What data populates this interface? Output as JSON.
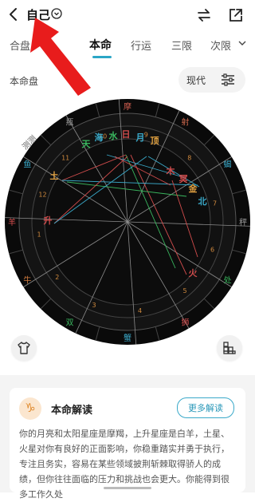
{
  "header": {
    "title": "自己"
  },
  "tabs": [
    {
      "label": "合盘"
    },
    {
      "label": "本命"
    },
    {
      "label": "行运"
    },
    {
      "label": "三限"
    },
    {
      "label": "次限"
    }
  ],
  "section_label": "本命盘",
  "mode": {
    "label": "现代"
  },
  "chart": {
    "watermark": "测测",
    "signs": [
      "摩",
      "射",
      "蝎",
      "秤",
      "处",
      "狮",
      "蟹",
      "双",
      "牛",
      "羊",
      "鱼",
      "瓶"
    ],
    "sign_colors": [
      "#c85a4c",
      "#d06a4e",
      "#3aa9c9",
      "#9a9a9a",
      "#3ab85f",
      "#d04c4c",
      "#3aa9c9",
      "#3ab85f",
      "#d07a3e",
      "#d04c4c",
      "#3aa9c9",
      "#9a9a9a"
    ],
    "house_numbers": [
      "1",
      "2",
      "3",
      "4",
      "5",
      "6",
      "7",
      "8",
      "9",
      "10",
      "11",
      "12"
    ],
    "planets": [
      {
        "label": "天",
        "color": "#3ab85f"
      },
      {
        "label": "海",
        "color": "#3aa9c9"
      },
      {
        "label": "水",
        "color": "#3ab85f"
      },
      {
        "label": "日",
        "color": "#d04c4c"
      },
      {
        "label": "月",
        "color": "#3aa9c9"
      },
      {
        "label": "顶",
        "color": "#e0a040"
      },
      {
        "label": "土",
        "color": "#e0a040"
      },
      {
        "label": "木",
        "color": "#d04c4c"
      },
      {
        "label": "冥",
        "color": "#d04c4c"
      },
      {
        "label": "金",
        "color": "#e0a040"
      },
      {
        "label": "北",
        "color": "#3aa9c9"
      },
      {
        "label": "升",
        "color": "#d04c4c"
      },
      {
        "label": "火",
        "color": "#d04c4c"
      }
    ]
  },
  "card": {
    "title": "本命解读",
    "more_label": "更多解读",
    "sign_glyph": "♑",
    "text": "你的月亮和太阳星座是摩羯，上升星座是白羊，土星、火星对你有良好的正面影响，你稳重踏实并勇于执行，专注且务实，容易在某些领域披荆斩棘取得骄人的成绩，但你往往面临的压力和挑战也会更大。你能得到很多工作久处"
  },
  "icons": {
    "back": "back-arrow-icon",
    "chevron": "chevron-down-icon",
    "swap": "swap-icon",
    "share": "share-icon",
    "settings": "sliders-icon",
    "tshirt": "tshirt-icon",
    "blocks": "blocks-icon",
    "annotation": "red-arrow-annotation"
  }
}
